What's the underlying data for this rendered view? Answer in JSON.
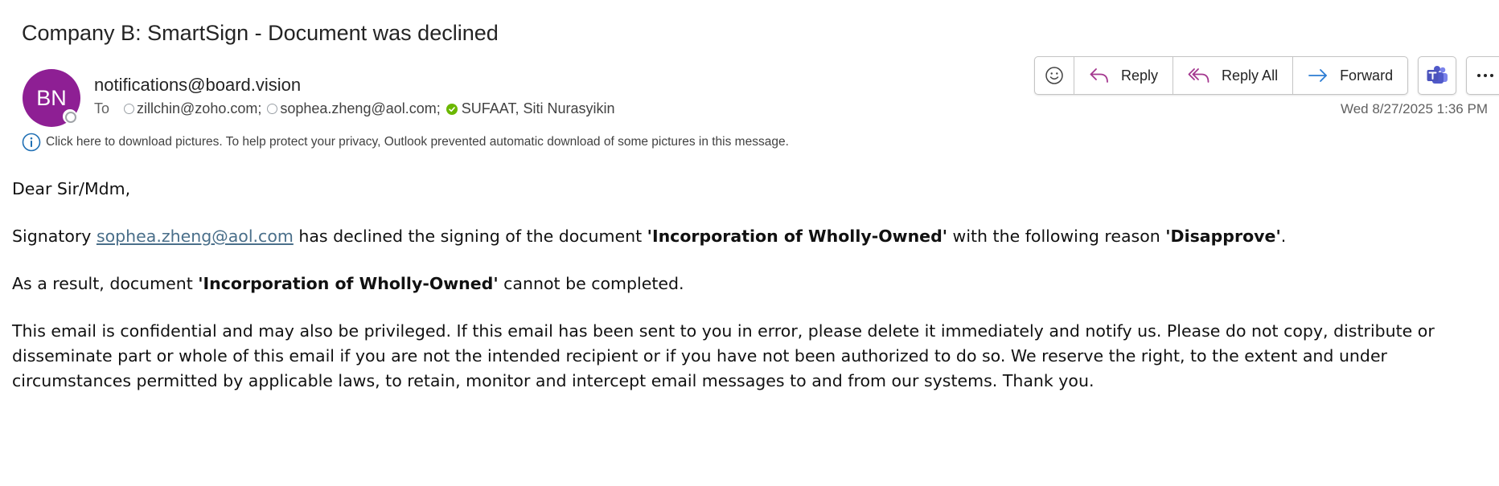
{
  "email": {
    "subject": "Company B: SmartSign - Document was declined",
    "avatar_initials": "BN",
    "avatar_color": "#8e1f94",
    "sender": "notifications@board.vision",
    "to_label": "To",
    "recipients": [
      {
        "name": "zillchin@zoho.com;",
        "status": "offline"
      },
      {
        "name": "sophea.zheng@aol.com;",
        "status": "offline"
      },
      {
        "name": "SUFAAT, Siti Nurasyikin",
        "status": "available"
      }
    ],
    "info_bar_text": "Click here to download pictures. To help protect your privacy, Outlook prevented automatic download of some pictures in this message.",
    "date": "Wed 8/27/2025 1:36 PM"
  },
  "actions": {
    "reply_label": "Reply",
    "reply_all_label": "Reply All",
    "forward_label": "Forward",
    "icons": [
      "emoji-icon",
      "reply-icon",
      "reply-all-icon",
      "forward-icon",
      "teams-icon",
      "more-icon"
    ]
  },
  "body": {
    "greeting": "Dear Sir/Mdm,",
    "p1_pre": "Signatory ",
    "p1_link": "sophea.zheng@aol.com",
    "p1_mid": " has declined the signing of the document ",
    "p1_doc": "'Incorporation of Wholly-Owned'",
    "p1_mid2": " with the following reason ",
    "p1_reason": "'Disapprove'",
    "p1_end": ".",
    "p2_pre": "As a result, document ",
    "p2_doc": "'Incorporation of Wholly-Owned'",
    "p2_end": " cannot be completed.",
    "disclaimer": "This email is confidential and may also be privileged. If this email has been sent to you in error, please delete it immediately and notify us. Please do not copy, distribute or disseminate part or whole of this email if you are not the intended recipient or if you have not been authorized to do so. We reserve the right, to the extent and under circumstances permitted by applicable laws, to retain, monitor and intercept email messages to and from our systems. Thank you."
  },
  "colors": {
    "accent_purple": "#8e1f94",
    "reply_icon": "#a4378f",
    "forward_icon": "#2b7cd3",
    "link": "#4a6f8a",
    "presence_available": "#6bb700"
  }
}
